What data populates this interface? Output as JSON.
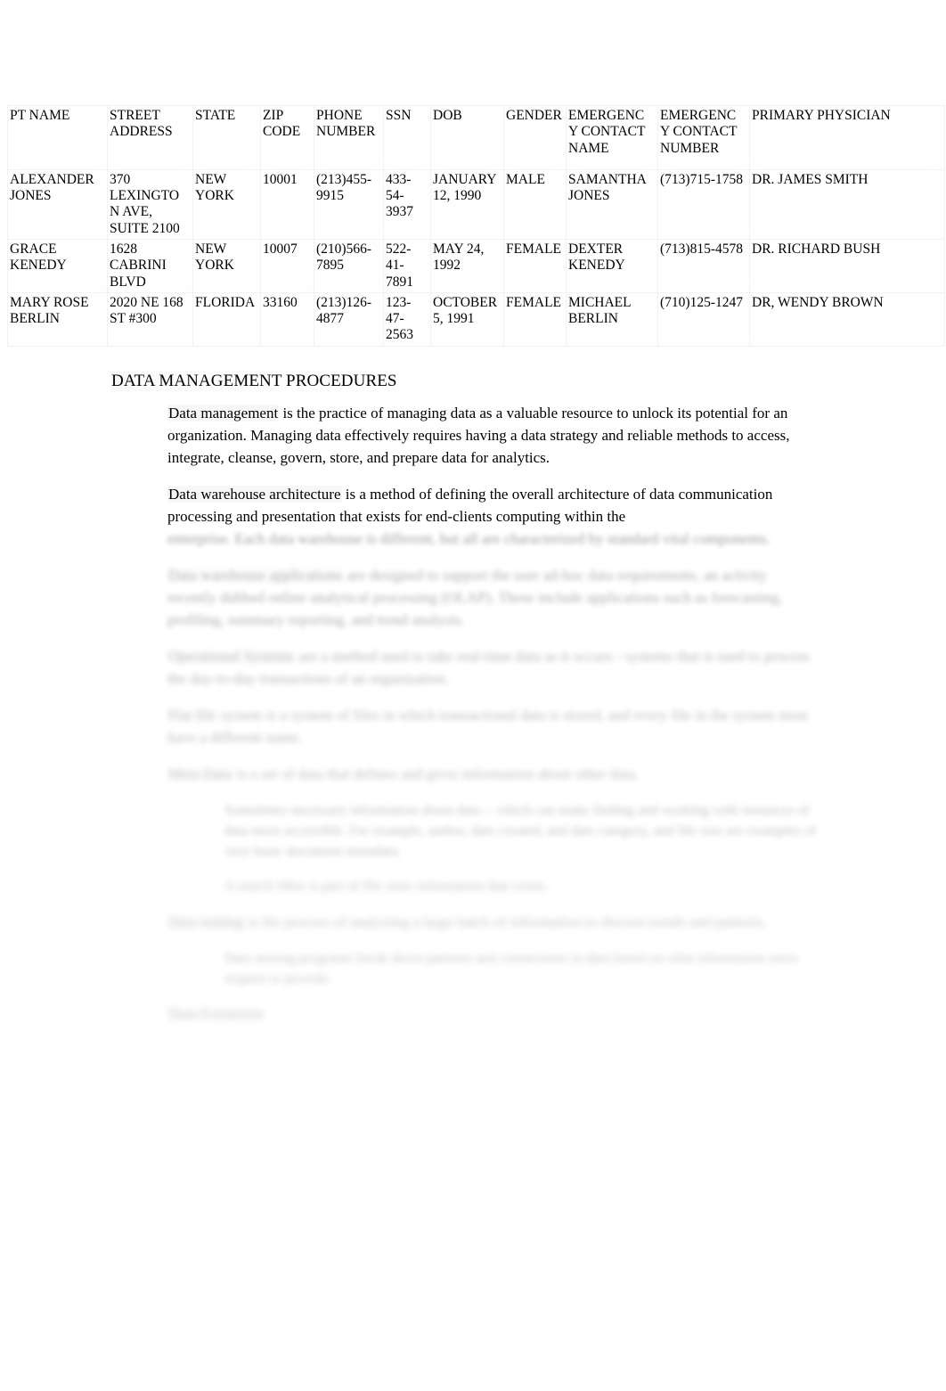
{
  "table": {
    "headers": [
      "PT NAME",
      "STREET ADDRESS",
      "STATE",
      "ZIP CODE",
      "PHONE NUMBER",
      "SSN",
      "DOB",
      "GENDER",
      "EMERGENCY CONTACT NAME",
      "EMERGENCY CONTACT NUMBER",
      "PRIMARY PHYSICIAN"
    ],
    "rows": [
      {
        "pt_name": "ALEXANDER JONES",
        "street_address": "370 LEXINGTON AVE, SUITE 2100",
        "state": "NEW YORK",
        "zip_code": "10001",
        "phone_number": "(213)455-9915",
        "ssn": "433-54-3937",
        "dob": "JANUARY 12, 1990",
        "gender": "MALE",
        "emergency_contact_name": "SAMANTHA JONES",
        "emergency_contact_number": "(713)715-1758",
        "primary_physician": "DR. JAMES SMITH"
      },
      {
        "pt_name": "GRACE KENEDY",
        "street_address": "1628 CABRINI BLVD",
        "state": "NEW YORK",
        "zip_code": "10007",
        "phone_number": "(210)566-7895",
        "ssn": "522-41-7891",
        "dob": "MAY 24, 1992",
        "gender": "FEMALE",
        "emergency_contact_name": "DEXTER KENEDY",
        "emergency_contact_number": "(713)815-4578",
        "primary_physician": "DR. RICHARD BUSH"
      },
      {
        "pt_name": "MARY ROSE BERLIN",
        "street_address": "2020 NE 168 ST #300",
        "state": "FLORIDA",
        "zip_code": "33160",
        "phone_number": "(213)126-4877",
        "ssn": "123-47-2563",
        "dob": "OCTOBER 5, 1991",
        "gender": "FEMALE",
        "emergency_contact_name": "MICHAEL BERLIN",
        "emergency_contact_number": "(710)125-1247",
        "primary_physician": "DR, WENDY BROWN"
      }
    ]
  },
  "section": {
    "heading": "DATA MANAGEMENT PROCEDURES",
    "bullet_glyph": "\u0001",
    "sub_bullet_glyph": "\u0001"
  },
  "bullets": [
    {
      "term": "Data management",
      "body": "  is the practice of managing data as a valuable resource to unlock its potential for an organization. Managing data effectively requires having a data strategy and reliable methods to access, integrate, cleanse, govern, store, and prepare data for analytics.",
      "level": 1,
      "legibility": "clear"
    },
    {
      "term": "Data warehouse architecture",
      "body": "  is a method of defining the overall architecture of data communication processing and presentation that exists for end-clients computing within the",
      "tail": "enterprise. Each data warehouse is different, but all are characterized by standard vital components.",
      "level": 1,
      "legibility": "partially-blurred"
    },
    {
      "term": "Data warehouse applications",
      "body": " are designed to support the user ad-hoc data requirements, an activity recently dubbed online analytical processing (OLAP). These include applications such as forecasting, profiling, summary reporting, and trend analysis.",
      "level": 1,
      "legibility": "blurred"
    },
    {
      "term": "Operational Systems",
      "body": " are a method used to take real-time data as it occurs - systems that is used to process the day-to-day transactions of an organization.",
      "level": 1,
      "legibility": "blurred"
    },
    {
      "term": "Flat file",
      "body": " system is a system of files in which transactional data is stored, and every file in the system must have a different name.",
      "level": 1,
      "legibility": "blurred"
    },
    {
      "term": "Meta Data",
      "body": " is a set of data that defines and gives information about other data.",
      "level": 1,
      "legibility": "blurred"
    },
    {
      "term": "",
      "body": "Sometimes necessary information about data -- which can make finding and working with instances of data more accessible. For example, author, date created, and date category, and file size are examples of very basic document metadata.",
      "level": 2,
      "legibility": "blurred"
    },
    {
      "term": "",
      "body": "A search filter is part of file store information that exists.",
      "level": 2,
      "legibility": "blurred"
    },
    {
      "term": "Data mining",
      "body": " is the process of analyzing a large batch of information to discern trends and patterns.",
      "level": 1,
      "legibility": "blurred"
    },
    {
      "term": "",
      "body": "Data mining programs break down patterns and connections in data based on what information users request or provide.",
      "level": 2,
      "legibility": "blurred"
    },
    {
      "term": "Data Extraction",
      "body": "",
      "level": 1,
      "legibility": "blurred"
    }
  ]
}
